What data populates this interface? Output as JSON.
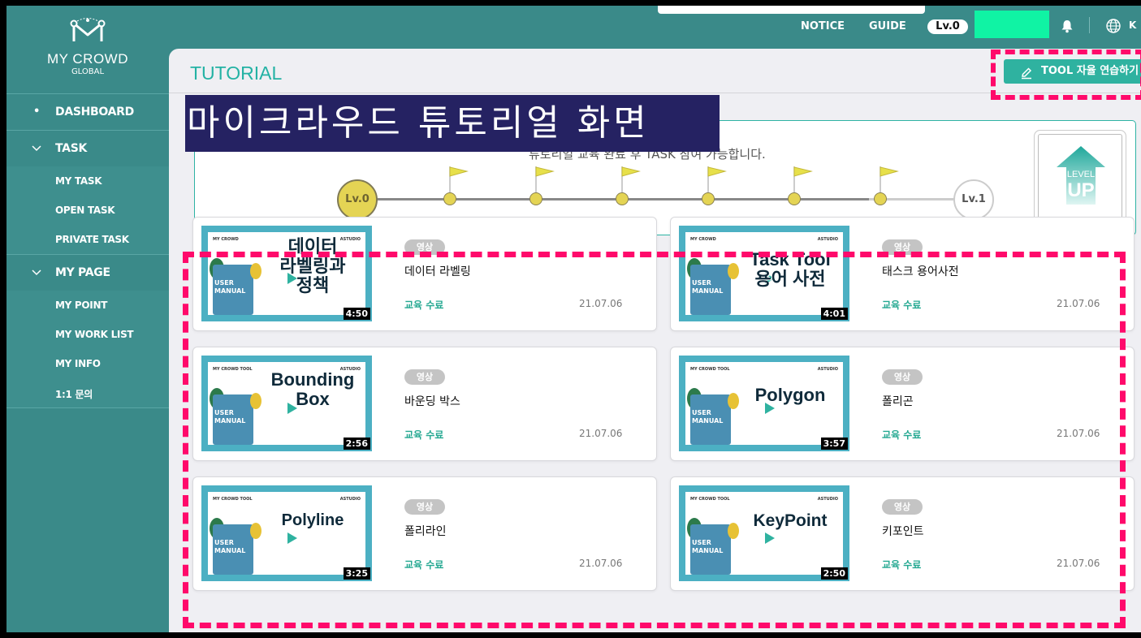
{
  "brand": {
    "name": "MY CROWD",
    "sub": "GLOBAL"
  },
  "sidebar": {
    "items": [
      {
        "mark": "•",
        "label": "DASHBOARD"
      },
      {
        "mark": "˅",
        "label": "TASK",
        "children": [
          "MY TASK",
          "OPEN TASK",
          "PRIVATE TASK"
        ]
      },
      {
        "mark": "˅",
        "label": "MY PAGE",
        "children": [
          "MY POINT",
          "MY WORK LIST",
          "MY INFO",
          "1:1 문의"
        ]
      }
    ]
  },
  "topbar": {
    "notice": "NOTICE",
    "guide": "GUIDE",
    "level": "Lv.0",
    "lang": "K"
  },
  "page": {
    "title": "TUTORIAL",
    "tool_button": "TOOL 자율 연습하기",
    "overlay": "마이크라우드 튜토리얼 화면"
  },
  "progress": {
    "message": "튜토리얼 교육 완료 후 TASK 참여 가능합니다.",
    "start": "Lv.0",
    "end": "Lv.1",
    "steps": 6,
    "completed_steps": 0,
    "levelup": {
      "line1": "LEVEL",
      "line2": "UP"
    }
  },
  "thumb_header": {
    "left": "MY CROWD",
    "left_tool": "MY CROWD TOOL",
    "right": "ASTUDIO"
  },
  "videos": [
    {
      "thumb_title": "데이터\n라벨링과\n정책",
      "book": "USER\nMANUAL",
      "duration": "4:50",
      "tag": "영상",
      "title": "데이터 라벨링",
      "status": "교육 수료",
      "date": "21.07.06"
    },
    {
      "thumb_title": "Task Tool\n용어 사전",
      "book": "USER\nMANUAL",
      "duration": "4:01",
      "tag": "영상",
      "title": "태스크 용어사전",
      "status": "교육 수료",
      "date": "21.07.06"
    },
    {
      "thumb_title": "Bounding\nBox",
      "book": "USER\nMANUAL",
      "duration": "2:56",
      "tag": "영상",
      "title": "바운딩 박스",
      "status": "교육 수료",
      "date": "21.07.06"
    },
    {
      "thumb_title": "Polygon",
      "book": "USER\nMANUAL",
      "duration": "3:57",
      "tag": "영상",
      "title": "폴리곤",
      "status": "교육 수료",
      "date": "21.07.06"
    },
    {
      "thumb_title": "Polyline",
      "book": "USER\nMANUAL",
      "duration": "3:25",
      "tag": "영상",
      "title": "폴리라인",
      "status": "교육 수료",
      "date": "21.07.06"
    },
    {
      "thumb_title": "KeyPoint",
      "book": "USER\nMANUAL",
      "duration": "2:50",
      "tag": "영상",
      "title": "키포인트",
      "status": "교육 수료",
      "date": "21.07.06"
    }
  ],
  "colors": {
    "teal": "#3a8a89",
    "accent": "#2fb2a0",
    "highlight": "#ff0a6b",
    "overlay_bg": "#252262",
    "level_yellow": "#e4d454"
  }
}
